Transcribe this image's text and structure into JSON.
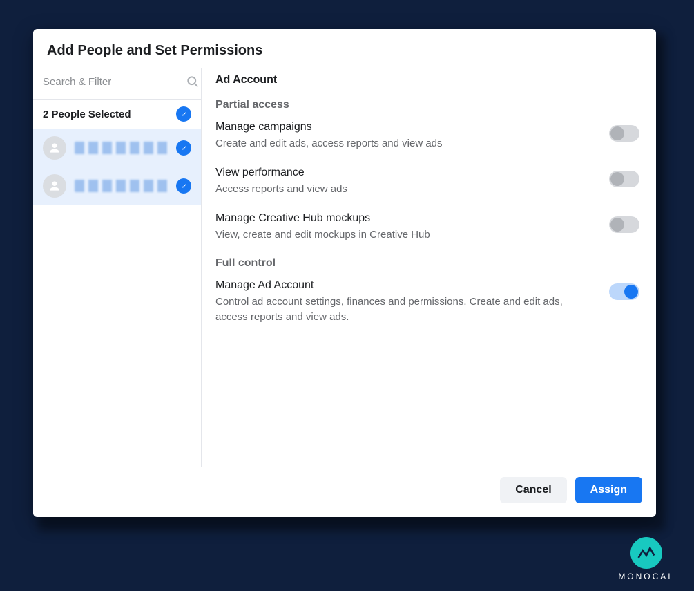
{
  "modal": {
    "title": "Add People and Set Permissions",
    "search_placeholder": "Search & Filter",
    "selected_label": "2 People Selected"
  },
  "right": {
    "header": "Ad Account",
    "partial_label": "Partial access",
    "full_label": "Full control"
  },
  "permissions": [
    {
      "title": "Manage campaigns",
      "desc": "Create and edit ads, access reports and view ads",
      "on": false
    },
    {
      "title": "View performance",
      "desc": "Access reports and view ads",
      "on": false
    },
    {
      "title": "Manage Creative Hub mockups",
      "desc": "View, create and edit mockups in Creative Hub",
      "on": false
    },
    {
      "title": "Manage Ad Account",
      "desc": "Control ad account settings, finances and permissions. Create and edit ads, access reports and view ads.",
      "on": true
    }
  ],
  "footer": {
    "cancel": "Cancel",
    "assign": "Assign"
  },
  "brand": {
    "name": "MONOCAL"
  }
}
